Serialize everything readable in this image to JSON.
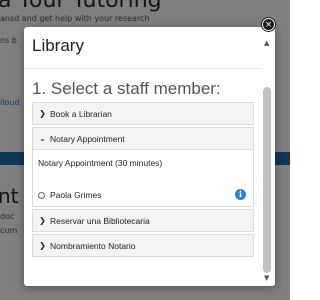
{
  "background": {
    "title": "a Your Tutoring",
    "lines": [
      "ansd and get help with your research",
      "ns b",
      "iloud",
      "doc",
      "cum"
    ],
    "heading": "nt"
  },
  "modal": {
    "title": "Library",
    "close_label": "×",
    "step_heading": "1. Select a staff member:",
    "items": [
      {
        "label": "Book a Librarian",
        "icon": "chevron-right-icon"
      },
      {
        "label": "Notary Appointment",
        "icon": "chevron-down-icon"
      },
      {
        "label": "Reservar una Bibliotecaria",
        "icon": "chevron-right-icon"
      },
      {
        "label": "Nombramiento Notario",
        "icon": "chevron-right-icon"
      }
    ],
    "expanded": {
      "appointment": "Notary Appointment (30 minutes)",
      "staff": [
        {
          "name": "Paola Grimes",
          "selected": false
        }
      ],
      "info_icon": "i"
    }
  },
  "colors": {
    "band": "#1f6fa8",
    "info": "#2a7fd4"
  }
}
